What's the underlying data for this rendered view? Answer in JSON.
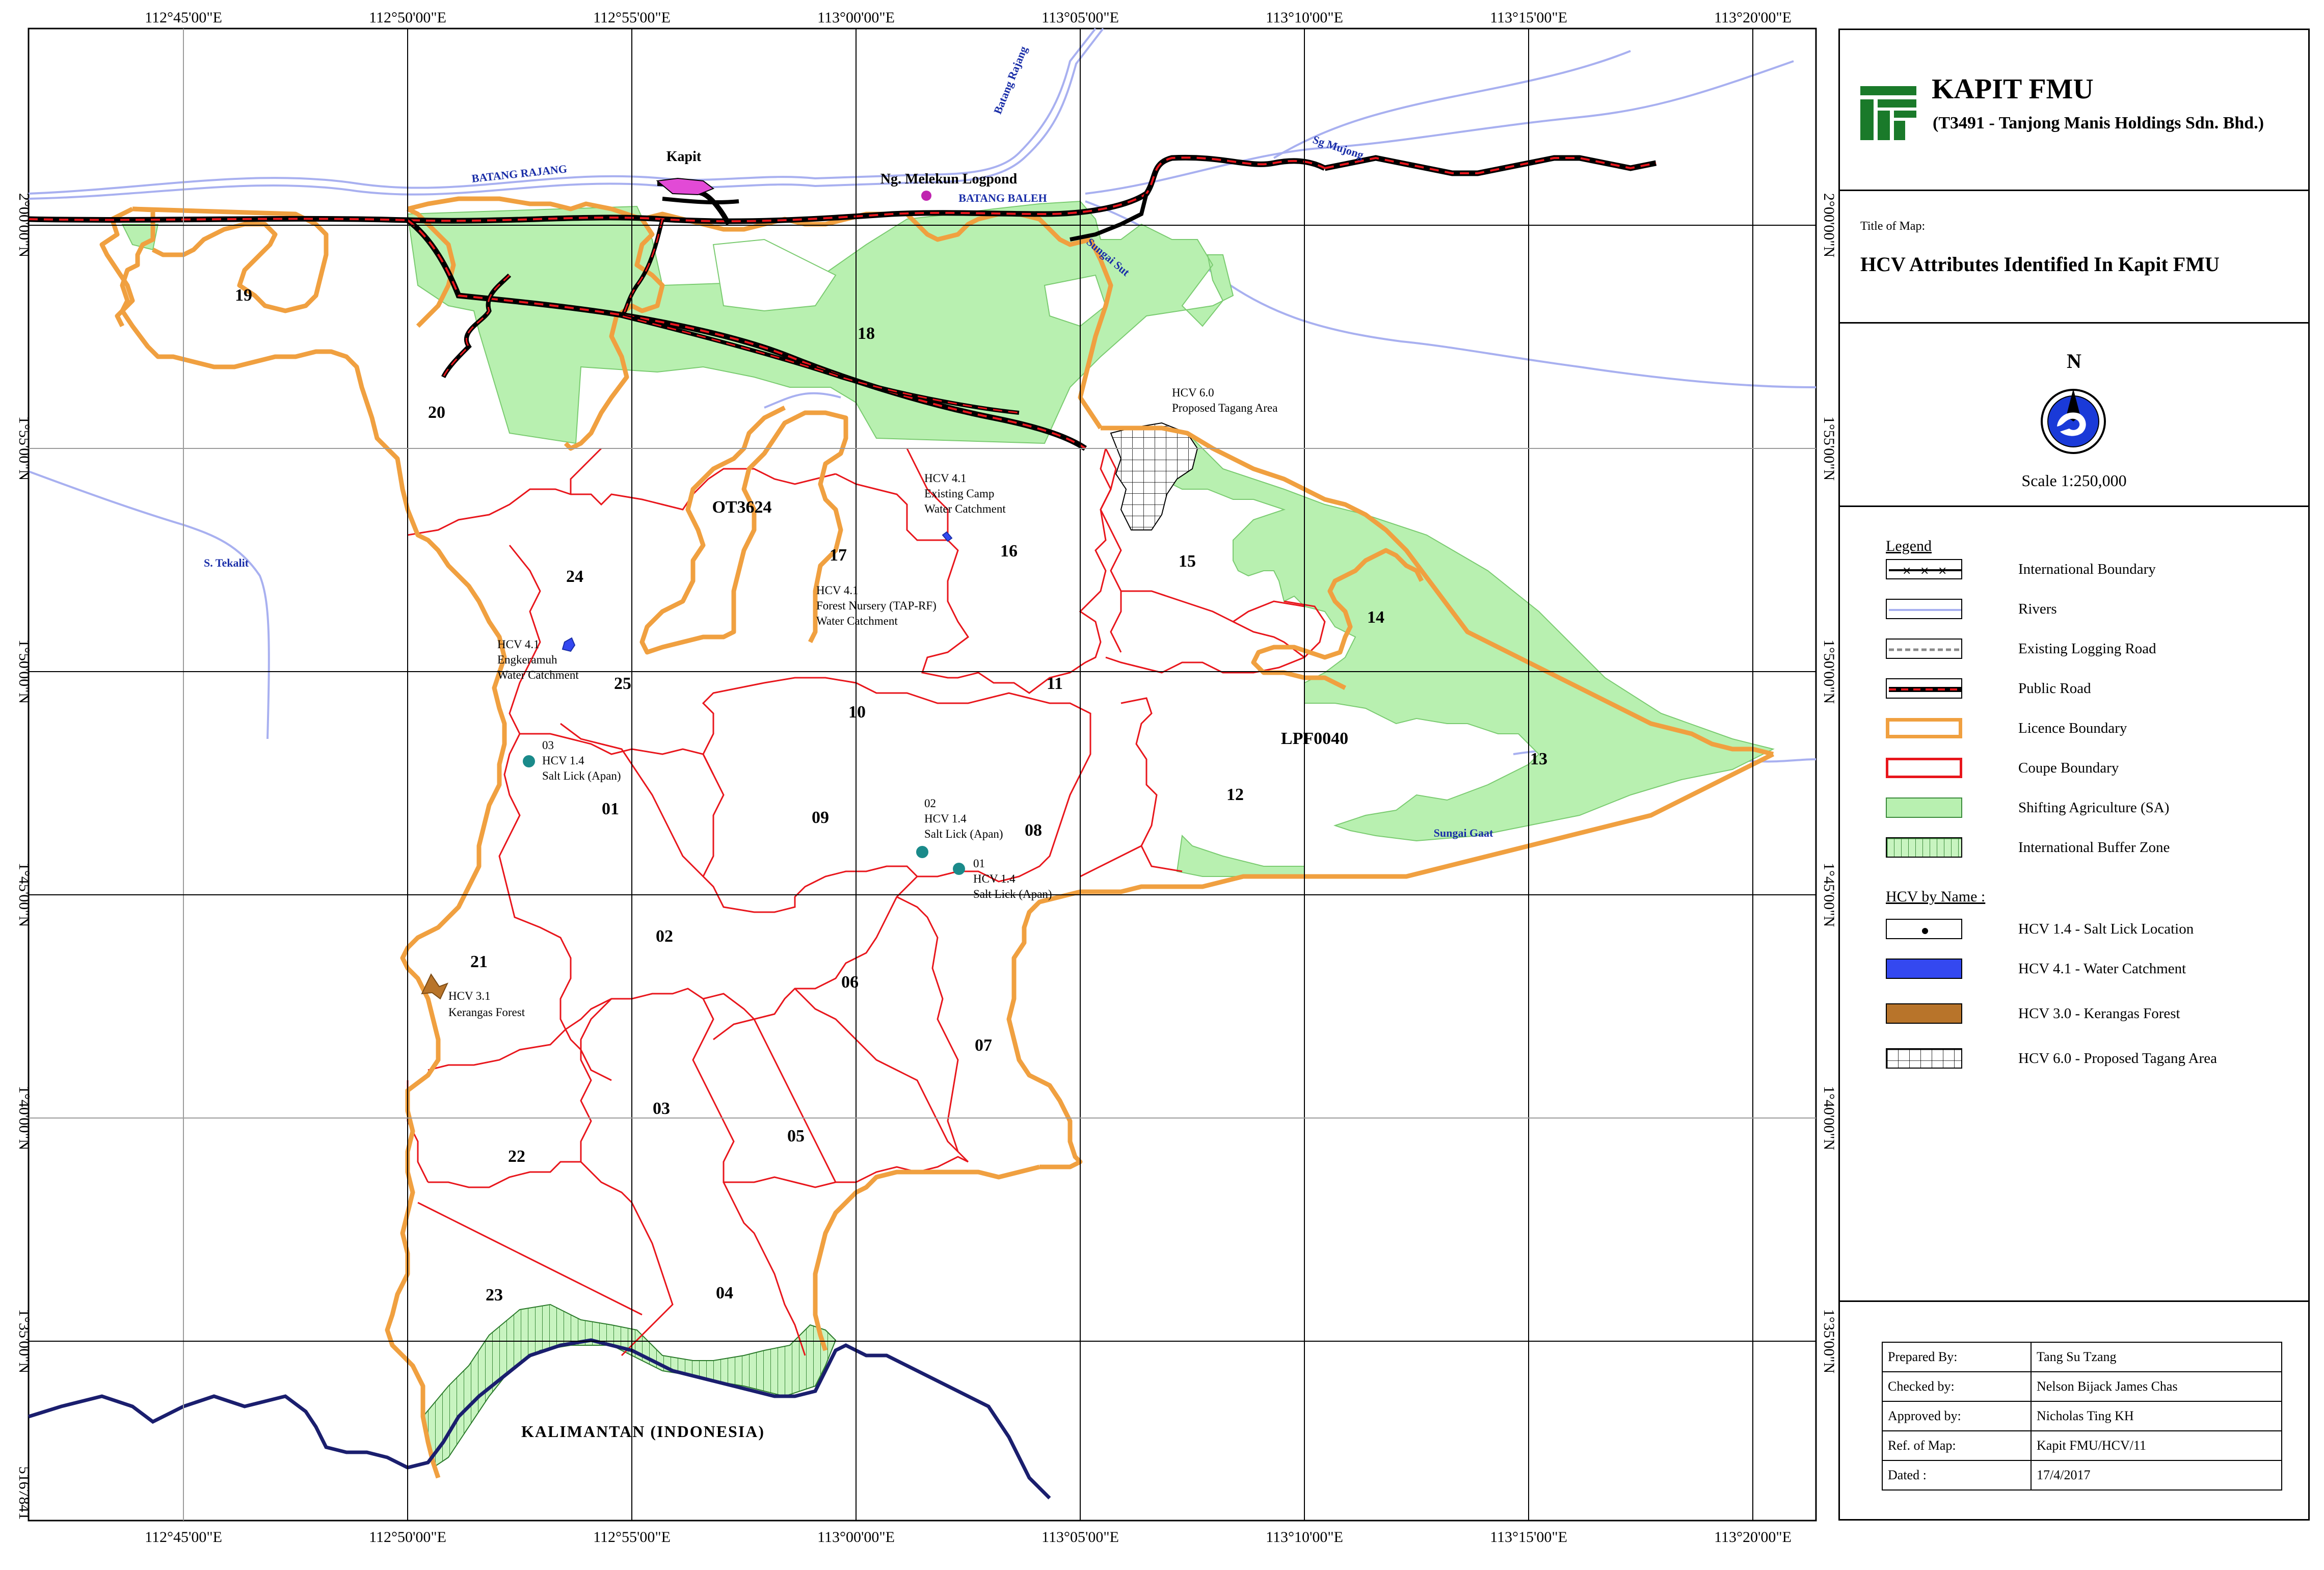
{
  "coord_labels": {
    "lon": [
      "112°45'00\"E",
      "112°50'00\"E",
      "112°55'00\"E",
      "113°00'00\"E",
      "113°05'00\"E",
      "113°10'00\"E",
      "113°15'00\"E",
      "113°20'00\"E"
    ],
    "lon_bottom": [
      "112°45'00\"E",
      "112°50'00\"E",
      "112°55'00\"E",
      "113°00'00\"E",
      "113°05'00\"E",
      "113°10'00\"E",
      "113°15'00\"E",
      "113°20'00\"E"
    ],
    "lat": [
      "2°00'00\"N",
      "1°55'00\"N",
      "1°50'00\"N",
      "1°45'00\"N",
      "1°40'00\"N",
      "1°35'00\"N"
    ],
    "corner_bottom": "5167841"
  },
  "blocks": [
    "19",
    "20",
    "18",
    "24",
    "17",
    "16",
    "15",
    "14",
    "25",
    "10",
    "11",
    "13",
    "12",
    "01",
    "09",
    "08",
    "02",
    "06",
    "21",
    "07",
    "03",
    "05",
    "22",
    "04",
    "23"
  ],
  "area_labels": {
    "ot": "OT3624",
    "lpf": "LPF0040",
    "kalimantan": "KALIMANTAN  (INDONESIA)",
    "kapit": "Kapit",
    "logpond": "Ng. Melekun Logpond"
  },
  "rivers": {
    "batang_rajang_w": "BATANG RAJANG",
    "batang_rajang_n": "Batang Rajang",
    "batang_baleh": "BATANG BALEH",
    "sg_mujong": "Sg Mujong",
    "sungai_sut": "Sungai Sut",
    "s_tekalit": "S. Tekalit",
    "sungai_gaat": "Sungai  Gaat"
  },
  "hcv_labels": {
    "tagang": [
      "HCV 6.0",
      "Proposed Tagang Area"
    ],
    "camp": [
      "HCV 4.1",
      "Existing Camp",
      "Water Catchment"
    ],
    "nursery": [
      "HCV 4.1",
      "Forest Nursery (TAP-RF)",
      "Water Catchment"
    ],
    "engkeramuh": [
      "HCV 4.1",
      "Engkeramuh",
      "Water Catchment"
    ],
    "salt03": [
      "03",
      "HCV 1.4",
      "Salt Lick (Apan)"
    ],
    "salt02": [
      "02",
      "HCV 1.4",
      "Salt Lick (Apan)"
    ],
    "salt01": [
      "01",
      "HCV 1.4",
      "Salt Lick (Apan)"
    ],
    "kerangas": [
      "HCV 3.1",
      "Kerangas Forest"
    ]
  },
  "panel": {
    "brand_name": "KAPIT FMU",
    "brand_sub": "(T3491 - Tanjong Manis Holdings Sdn. Bhd.)",
    "title_of_map_label": "Title of Map:",
    "map_title": "HCV Attributes Identified In Kapit FMU",
    "north": "N",
    "scale": "Scale 1:250,000",
    "legend_title": "Legend",
    "legend": [
      {
        "label": "International Boundary"
      },
      {
        "label": "Rivers"
      },
      {
        "label": "Existing Logging Road"
      },
      {
        "label": "Public Road"
      },
      {
        "label": "Licence Boundary"
      },
      {
        "label": "Coupe Boundary"
      },
      {
        "label": "Shifting Agriculture  (SA)"
      },
      {
        "label": "International Buffer Zone"
      }
    ],
    "hcv_title": "HCV by Name :",
    "hcv_legend": [
      {
        "label": "HCV 1.4 - Salt Lick Location"
      },
      {
        "label": "HCV 4.1 - Water Catchment"
      },
      {
        "label": "HCV 3.0 - Kerangas Forest"
      },
      {
        "label": "HCV 6.0 - Proposed Tagang Area"
      }
    ],
    "info": [
      {
        "k": "Prepared By:",
        "v": "Tang Su Tzang"
      },
      {
        "k": "Checked by:",
        "v": "Nelson Bijack James Chas"
      },
      {
        "k": "Approved by:",
        "v": "Nicholas Ting KH"
      },
      {
        "k": "Ref. of Map:",
        "v": "Kapit FMU/HCV/11"
      },
      {
        "k": "Dated :",
        "v": "17/4/2017"
      }
    ]
  },
  "colors": {
    "licence": "#f0a040",
    "coupe": "#e8161c",
    "sa": "#b8f0b0",
    "river": "#a8b0f0",
    "intl": "#1a1e6e",
    "hcv41": "#3448f0",
    "hcv30": "#b8742a",
    "salt": "#1a8a8a"
  }
}
